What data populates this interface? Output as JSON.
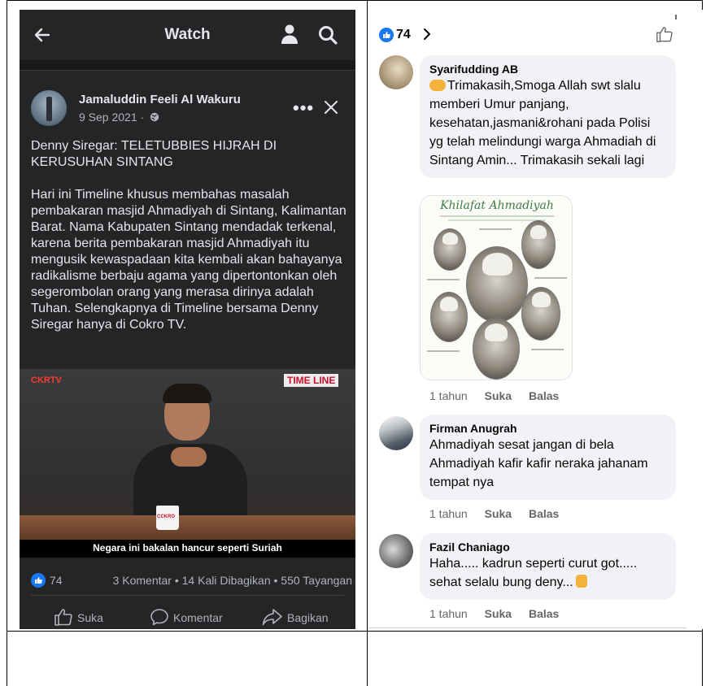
{
  "watch_screen": {
    "header": {
      "title": "Watch",
      "back_icon": "arrow-left-icon",
      "profile_icon": "person-icon",
      "search_icon": "search-icon"
    },
    "post": {
      "author": "Jamaluddin Feeli Al Wakuru",
      "date": "9 Sep 2021 ·",
      "privacy_icon": "globe-icon",
      "more_icon": "more-horizontal-icon",
      "close_icon": "close-icon",
      "title": "Denny Siregar: TELETUBBIES HIJRAH DI KERUSUHAN SINTANG",
      "body": "Hari ini Timeline khusus membahas masalah pembakaran masjid Ahmadiyah di Sintang, Kalimantan Barat. Nama Kabupaten Sintang mendadak terkenal, karena berita pembakaran masjid Ahmadiyah itu mengusik kewaspadaan kita kembali akan bahayanya radikalisme berbaju agama yang dipertontonkan oleh segerombolan orang yang merasa dirinya adalah Tuhan. Selengkapnya di Timeline bersama Denny Siregar hanya di Cokro TV.",
      "video": {
        "channel_badge": "CKRTV",
        "show_logo": "TIME LINE",
        "mug_text": "CCKRO",
        "subtitle": "Negara ini bakalan hancur seperti Suriah"
      },
      "stats": {
        "likes": "74",
        "summary": "3 Komentar • 14 Kali Dibagikan • 550 Tayangan"
      },
      "actions": {
        "like": "Suka",
        "comment": "Komentar",
        "share": "Bagikan"
      }
    }
  },
  "comments_screen": {
    "header": {
      "likes": "74",
      "chevron_icon": "chevron-right-icon",
      "thumb_icon": "thumbs-up-outline-icon"
    },
    "comments": [
      {
        "name": "Syarifudding AB",
        "text": "Trimakasih,Smoga Allah swt slalu memberi Umur panjang, kesehatan,jasmani&rohani  pada Polisi yg telah melindungi warga Ahmadiah di Sintang Amin... Trimakasih sekali lagi",
        "image_title": "Khilafat Ahmadiyah",
        "time": "1 tahun",
        "like": "Suka",
        "reply": "Balas"
      },
      {
        "name": "Firman Anugrah",
        "text": "Ahmadiyah sesat jangan di bela\nAhmadiyah kafir kafir neraka jahanam tempat nya",
        "time": "1 tahun",
        "like": "Suka",
        "reply": "Balas"
      },
      {
        "name": "Fazil Chaniago",
        "text": "Haha..... kadrun seperti curut got..... sehat selalu bung deny...",
        "time": "1 tahun",
        "like": "Suka",
        "reply": "Balas"
      }
    ]
  },
  "colors": {
    "dark_bg": "#18191a",
    "dark_card": "#242526",
    "facebook_blue": "#1877f2",
    "bubble_bg": "#f0f2f5"
  }
}
